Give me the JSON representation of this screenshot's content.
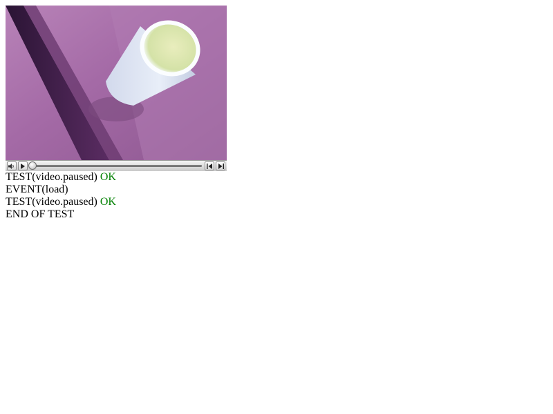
{
  "video": {
    "icons": {
      "volume": "speaker-icon",
      "play": "play-icon",
      "rewind": "step-back-icon",
      "forward": "step-forward-icon"
    },
    "progress": 0
  },
  "log": {
    "lines": [
      {
        "text": "TEST(video.paused)",
        "status": "OK"
      },
      {
        "text": "EVENT(load)"
      },
      {
        "text": "TEST(video.paused)",
        "status": "OK"
      },
      {
        "text": "END OF TEST"
      }
    ]
  },
  "colors": {
    "ok": "#008000"
  }
}
